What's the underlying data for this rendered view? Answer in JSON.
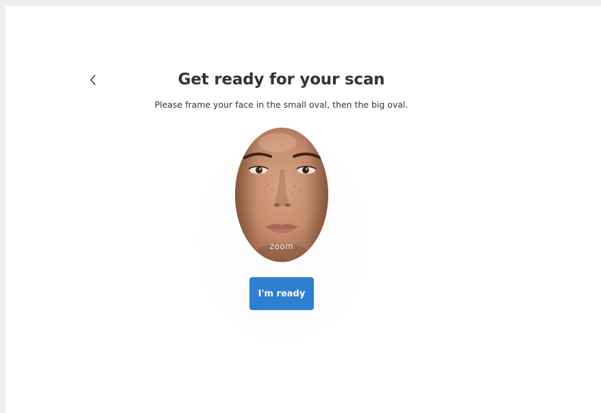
{
  "header": {
    "back_icon": "chevron-left-icon",
    "title": "Get ready for your scan",
    "subtitle": "Please frame your face in the small oval, then the big oval."
  },
  "face_preview": {
    "watermark": "zoom"
  },
  "actions": {
    "ready_label": "I'm ready"
  },
  "colors": {
    "primary_button": "#2f7fd1",
    "text": "#2f3439",
    "page_bg": "#efefef",
    "card_bg": "#ffffff"
  }
}
